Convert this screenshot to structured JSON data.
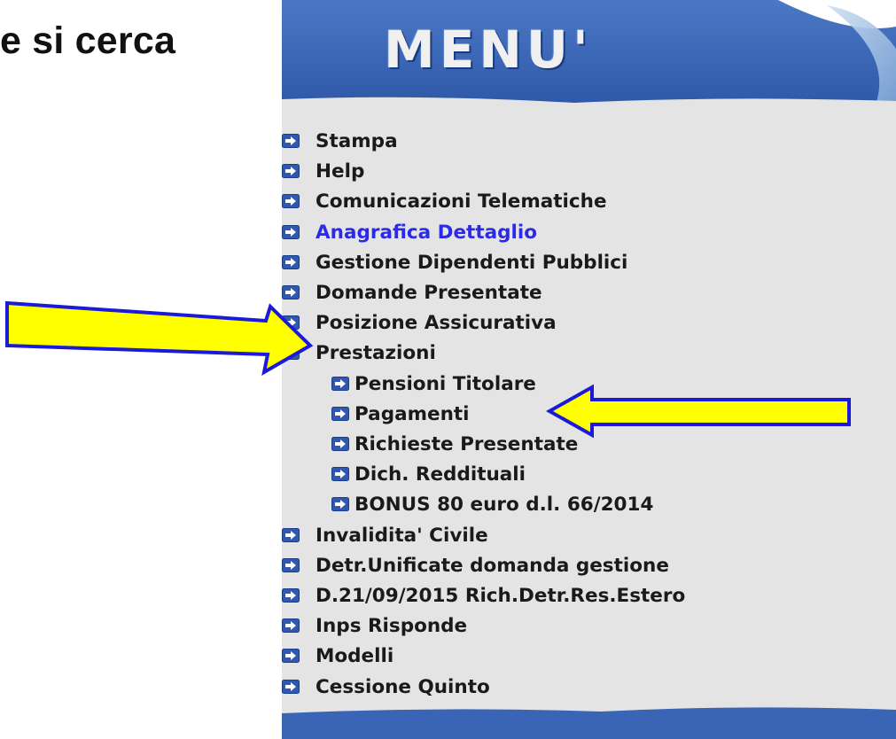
{
  "heading": "e si cerca",
  "menu": {
    "title": "MENU'",
    "items": [
      {
        "label": "Stampa",
        "level": 0,
        "bullet": "arrow-right-icon"
      },
      {
        "label": "Help",
        "level": 0,
        "bullet": "arrow-right-icon"
      },
      {
        "label": "Comunicazioni Telematiche",
        "level": 0,
        "bullet": "arrow-right-icon"
      },
      {
        "label": "Anagrafica Dettaglio",
        "level": 0,
        "bullet": "arrow-right-icon",
        "active": true
      },
      {
        "label": "Gestione Dipendenti Pubblici",
        "level": 0,
        "bullet": "arrow-right-icon"
      },
      {
        "label": "Domande Presentate",
        "level": 0,
        "bullet": "arrow-right-icon"
      },
      {
        "label": "Posizione Assicurativa",
        "level": 0,
        "bullet": "arrow-right-icon"
      },
      {
        "label": "Prestazioni",
        "level": 0,
        "bullet": "arrow-right-icon"
      },
      {
        "label": "Pensioni Titolare",
        "level": 1,
        "bullet": "arrow-right-icon"
      },
      {
        "label": "Pagamenti",
        "level": 1,
        "bullet": "arrow-right-icon"
      },
      {
        "label": "Richieste Presentate",
        "level": 1,
        "bullet": "arrow-right-icon"
      },
      {
        "label": "Dich. Reddituali",
        "level": 1,
        "bullet": "arrow-right-icon"
      },
      {
        "label": "BONUS 80 euro d.l. 66/2014",
        "level": 1,
        "bullet": "arrow-right-icon"
      },
      {
        "label": "Invalidita' Civile",
        "level": 0,
        "bullet": "arrow-right-icon"
      },
      {
        "label": "Detr.Unificate domanda gestione",
        "level": 0,
        "bullet": "arrow-right-icon"
      },
      {
        "label": "D.21/09/2015 Rich.Detr.Res.Estero",
        "level": 0,
        "bullet": "arrow-right-icon"
      },
      {
        "label": "Inps Risponde",
        "level": 0,
        "bullet": "arrow-right-icon"
      },
      {
        "label": "Modelli",
        "level": 0,
        "bullet": "arrow-right-icon"
      },
      {
        "label": "Cessione Quinto",
        "level": 0,
        "bullet": "arrow-right-icon"
      }
    ]
  },
  "annotations": [
    {
      "name": "highlight-arrow-prestazioni",
      "icon": "yellow-arrow-icon",
      "points_to": "Prestazioni"
    },
    {
      "name": "highlight-arrow-pagamenti",
      "icon": "yellow-arrow-icon",
      "points_to": "Pagamenti"
    }
  ],
  "colors": {
    "menu_blue": "#3a65b6",
    "menu_background": "#e4e4e4",
    "active_link": "#2a2ae8",
    "arrow_fill": "#ffff00",
    "arrow_border": "#1a1ad8"
  }
}
